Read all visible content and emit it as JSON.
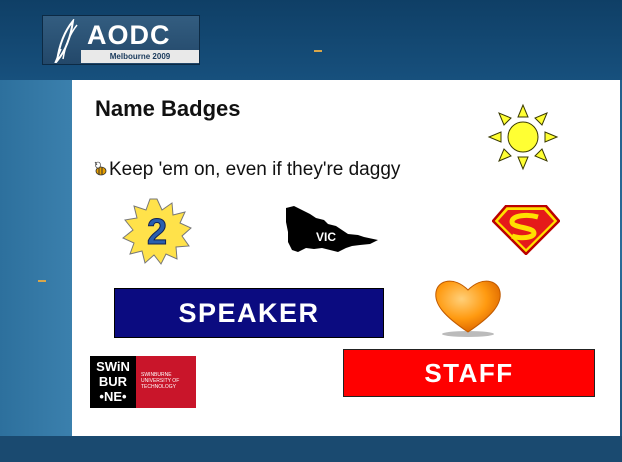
{
  "logo": {
    "name": "AODC",
    "subtitle": "Melbourne 2009"
  },
  "slide": {
    "title": "Name Badges",
    "bullet": "Keep 'em on, even if they're daggy"
  },
  "badges": {
    "number": "2",
    "vic": "VIC",
    "speaker": "SPEAKER",
    "staff": "STAFF",
    "swinburne": {
      "line1": "SWiN",
      "line2": "BUR",
      "line3": "•NE•",
      "red_text": "SWINBURNE UNIVERSITY OF TECHNOLOGY"
    }
  },
  "icons": [
    "feather-icon",
    "bee-bullet-icon",
    "sun-icon",
    "number-badge-icon",
    "victoria-map-icon",
    "superman-shield-icon",
    "heart-icon",
    "swinburne-logo"
  ],
  "colors": {
    "speaker_bg": "#0b0b80",
    "staff_bg": "#ff0000",
    "sun": "#ffff33",
    "heart": "#ff9a10",
    "background": "#1f5a86"
  }
}
